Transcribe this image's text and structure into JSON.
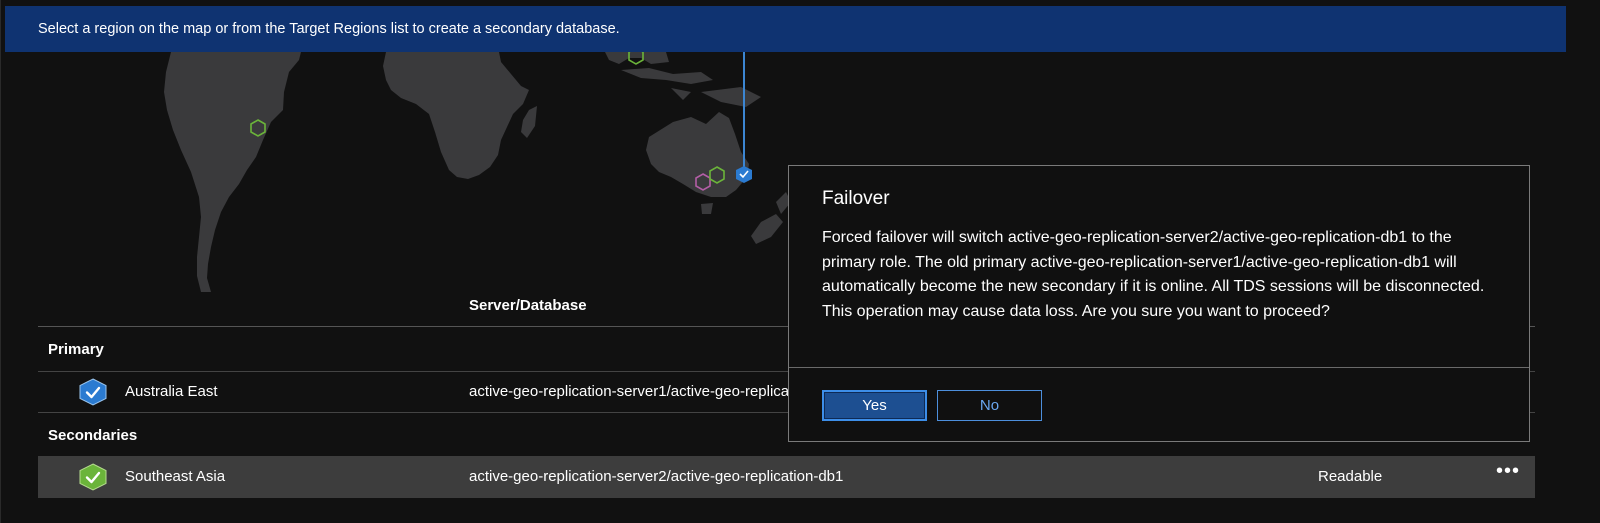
{
  "banner": {
    "text": "Select a region on the map or from the Target Regions list to create a secondary database."
  },
  "colors": {
    "banner_bg": "#0f3371",
    "primary_icon": "#2b7bd1",
    "secondary_icon": "#6bb43a",
    "land": "#3a3a3c",
    "button_accent": "#3d8ee8"
  },
  "table": {
    "columns": {
      "server_database": "Server/Database"
    },
    "groups": {
      "primary": {
        "label": "Primary",
        "rows": [
          {
            "region": "Australia East",
            "server_database": "active-geo-replication-server1/active-geo-replication-db1",
            "icon": "primary-check-hexagon-icon"
          }
        ]
      },
      "secondaries": {
        "label": "Secondaries",
        "rows": [
          {
            "region": "Southeast Asia",
            "server_database": "active-geo-replication-server2/active-geo-replication-db1",
            "readability": "Readable",
            "icon": "secondary-check-hexagon-icon",
            "more": "•••"
          }
        ]
      }
    }
  },
  "dialog": {
    "title": "Failover",
    "message": "Forced failover will switch active-geo-replication-server2/active-geo-replication-db1 to the primary role. The old primary active-geo-replication-server1/active-geo-replication-db1 will automatically become the new secondary if it is online. All TDS sessions will be disconnected. This operation may cause data loss. Are you sure you want to proceed?",
    "yes_label": "Yes",
    "no_label": "No"
  }
}
